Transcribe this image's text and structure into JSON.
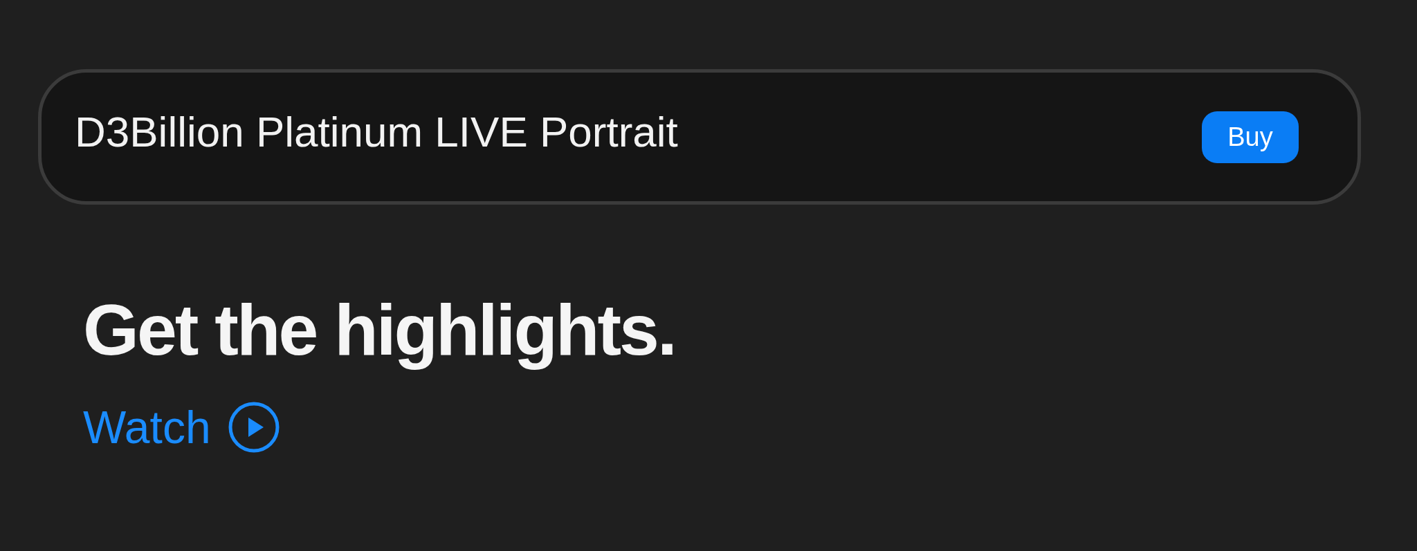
{
  "product_bar": {
    "title": "D3Billion Platinum LIVE Portrait",
    "button": "Buy"
  },
  "headline": "Get the highlights.",
  "watch_link": {
    "label": "Watch"
  }
}
